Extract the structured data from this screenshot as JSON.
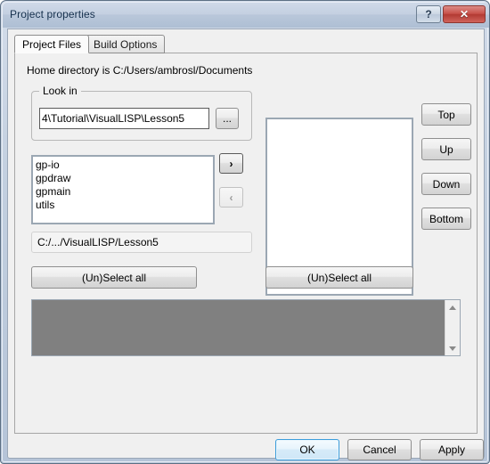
{
  "window": {
    "title": "Project properties",
    "help_label": "?",
    "close_label": "✕"
  },
  "tabs": [
    {
      "label": "Project Files",
      "active": true
    },
    {
      "label": "Build Options",
      "active": false
    }
  ],
  "main": {
    "home_directory_text": "Home directory is C:/Users/ambrosl/Documents",
    "lookin": {
      "legend": "Look in",
      "input_value": "4\\Tutorial\\VisualLISP\\Lesson5",
      "input_placeholder": "",
      "browse_label": "..."
    },
    "source_list": {
      "items": [
        "gp-io",
        "gpdraw",
        "gpmain",
        "utils"
      ],
      "path_label": "C:/.../VisualLISP/Lesson5",
      "select_all_label": "(Un)Select all"
    },
    "target_list": {
      "items": [],
      "select_all_label": "(Un)Select all"
    },
    "move_buttons": {
      "add_label": "›",
      "remove_label": "‹"
    },
    "order_buttons": [
      {
        "label": "Top"
      },
      {
        "label": "Up"
      },
      {
        "label": "Down"
      },
      {
        "label": "Bottom"
      }
    ],
    "output_pane": {
      "content": "",
      "scroll_up_label": "",
      "scroll_down_label": ""
    }
  },
  "footer": {
    "ok_label": "OK",
    "cancel_label": "Cancel",
    "apply_label": "Apply"
  },
  "colors": {
    "titlebar": "#c4d0e1",
    "close_button": "#c8514a",
    "dialog_face": "#f0f0f0",
    "output_disabled": "#808080",
    "focus_blue": "#3c9ddb"
  }
}
